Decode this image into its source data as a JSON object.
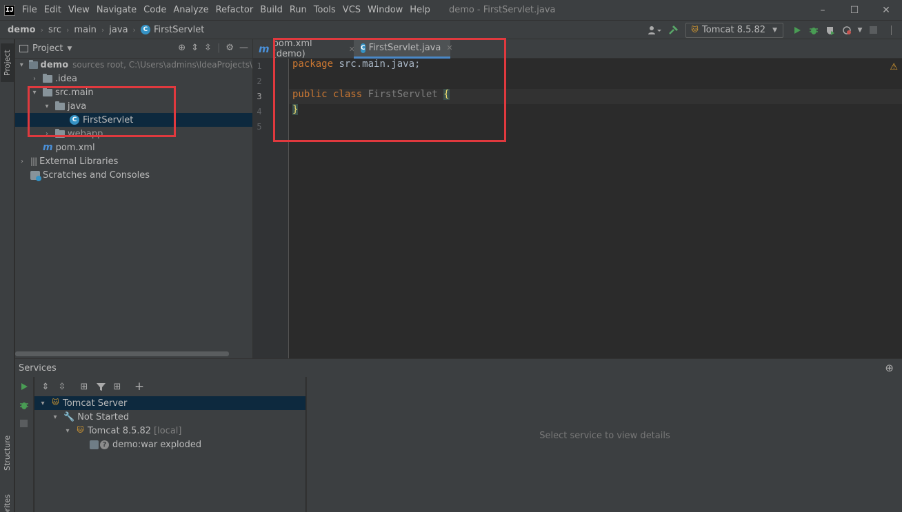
{
  "menubar": {
    "logo": "IJ",
    "items": [
      "File",
      "Edit",
      "View",
      "Navigate",
      "Code",
      "Analyze",
      "Refactor",
      "Build",
      "Run",
      "Tools",
      "VCS",
      "Window",
      "Help"
    ],
    "window_title": "demo - FirstServlet.java",
    "controls": [
      "–",
      "☐",
      "✕"
    ]
  },
  "navbar": {
    "breadcrumbs": [
      "demo",
      "src",
      "main",
      "java",
      "FirstServlet"
    ],
    "run_config": "Tomcat 8.5.82"
  },
  "left_strip": {
    "tabs": [
      "Project",
      "Structure",
      "Favorites"
    ]
  },
  "project": {
    "title": "Project",
    "tree": [
      {
        "label": "demo",
        "extra": "sources root,  C:\\Users\\admins\\IdeaProjects\\",
        "arrow": "▾",
        "kind": "module"
      },
      {
        "label": ".idea",
        "arrow": "›",
        "kind": "folder"
      },
      {
        "label": "src.main",
        "arrow": "▾",
        "kind": "folder"
      },
      {
        "label": "java",
        "arrow": "▾",
        "kind": "folder"
      },
      {
        "label": "FirstServlet",
        "arrow": "",
        "kind": "class",
        "selected": true
      },
      {
        "label": "webapp",
        "arrow": "›",
        "kind": "folder"
      },
      {
        "label": "pom.xml",
        "arrow": "",
        "kind": "maven"
      },
      {
        "label": "External Libraries",
        "arrow": "›",
        "kind": "lib"
      },
      {
        "label": "Scratches and Consoles",
        "arrow": "",
        "kind": "scratch"
      }
    ]
  },
  "editor": {
    "tabs": [
      {
        "label": "pom.xml (demo)",
        "icon": "m",
        "active": false
      },
      {
        "label": "FirstServlet.java",
        "icon": "c",
        "active": true
      }
    ],
    "line_numbers": [
      "1",
      "2",
      "3",
      "4",
      "5"
    ],
    "code": {
      "line1_kw": "package",
      "line1_rest": " src.main.java;",
      "line3_kw": "public class",
      "line3_name": " FirstServlet ",
      "line3_brace": "{",
      "line4_brace": "}"
    },
    "warning_icon": "⚠"
  },
  "services": {
    "title": "Services",
    "tree": [
      {
        "label": "Tomcat Server",
        "arrow": "▾",
        "selected": true
      },
      {
        "label": "Not Started",
        "arrow": "▾"
      },
      {
        "label": "Tomcat 8.5.82",
        "extra": "[local]",
        "arrow": "▾"
      },
      {
        "label": "demo:war exploded",
        "arrow": ""
      }
    ],
    "details_placeholder": "Select service to view details"
  }
}
